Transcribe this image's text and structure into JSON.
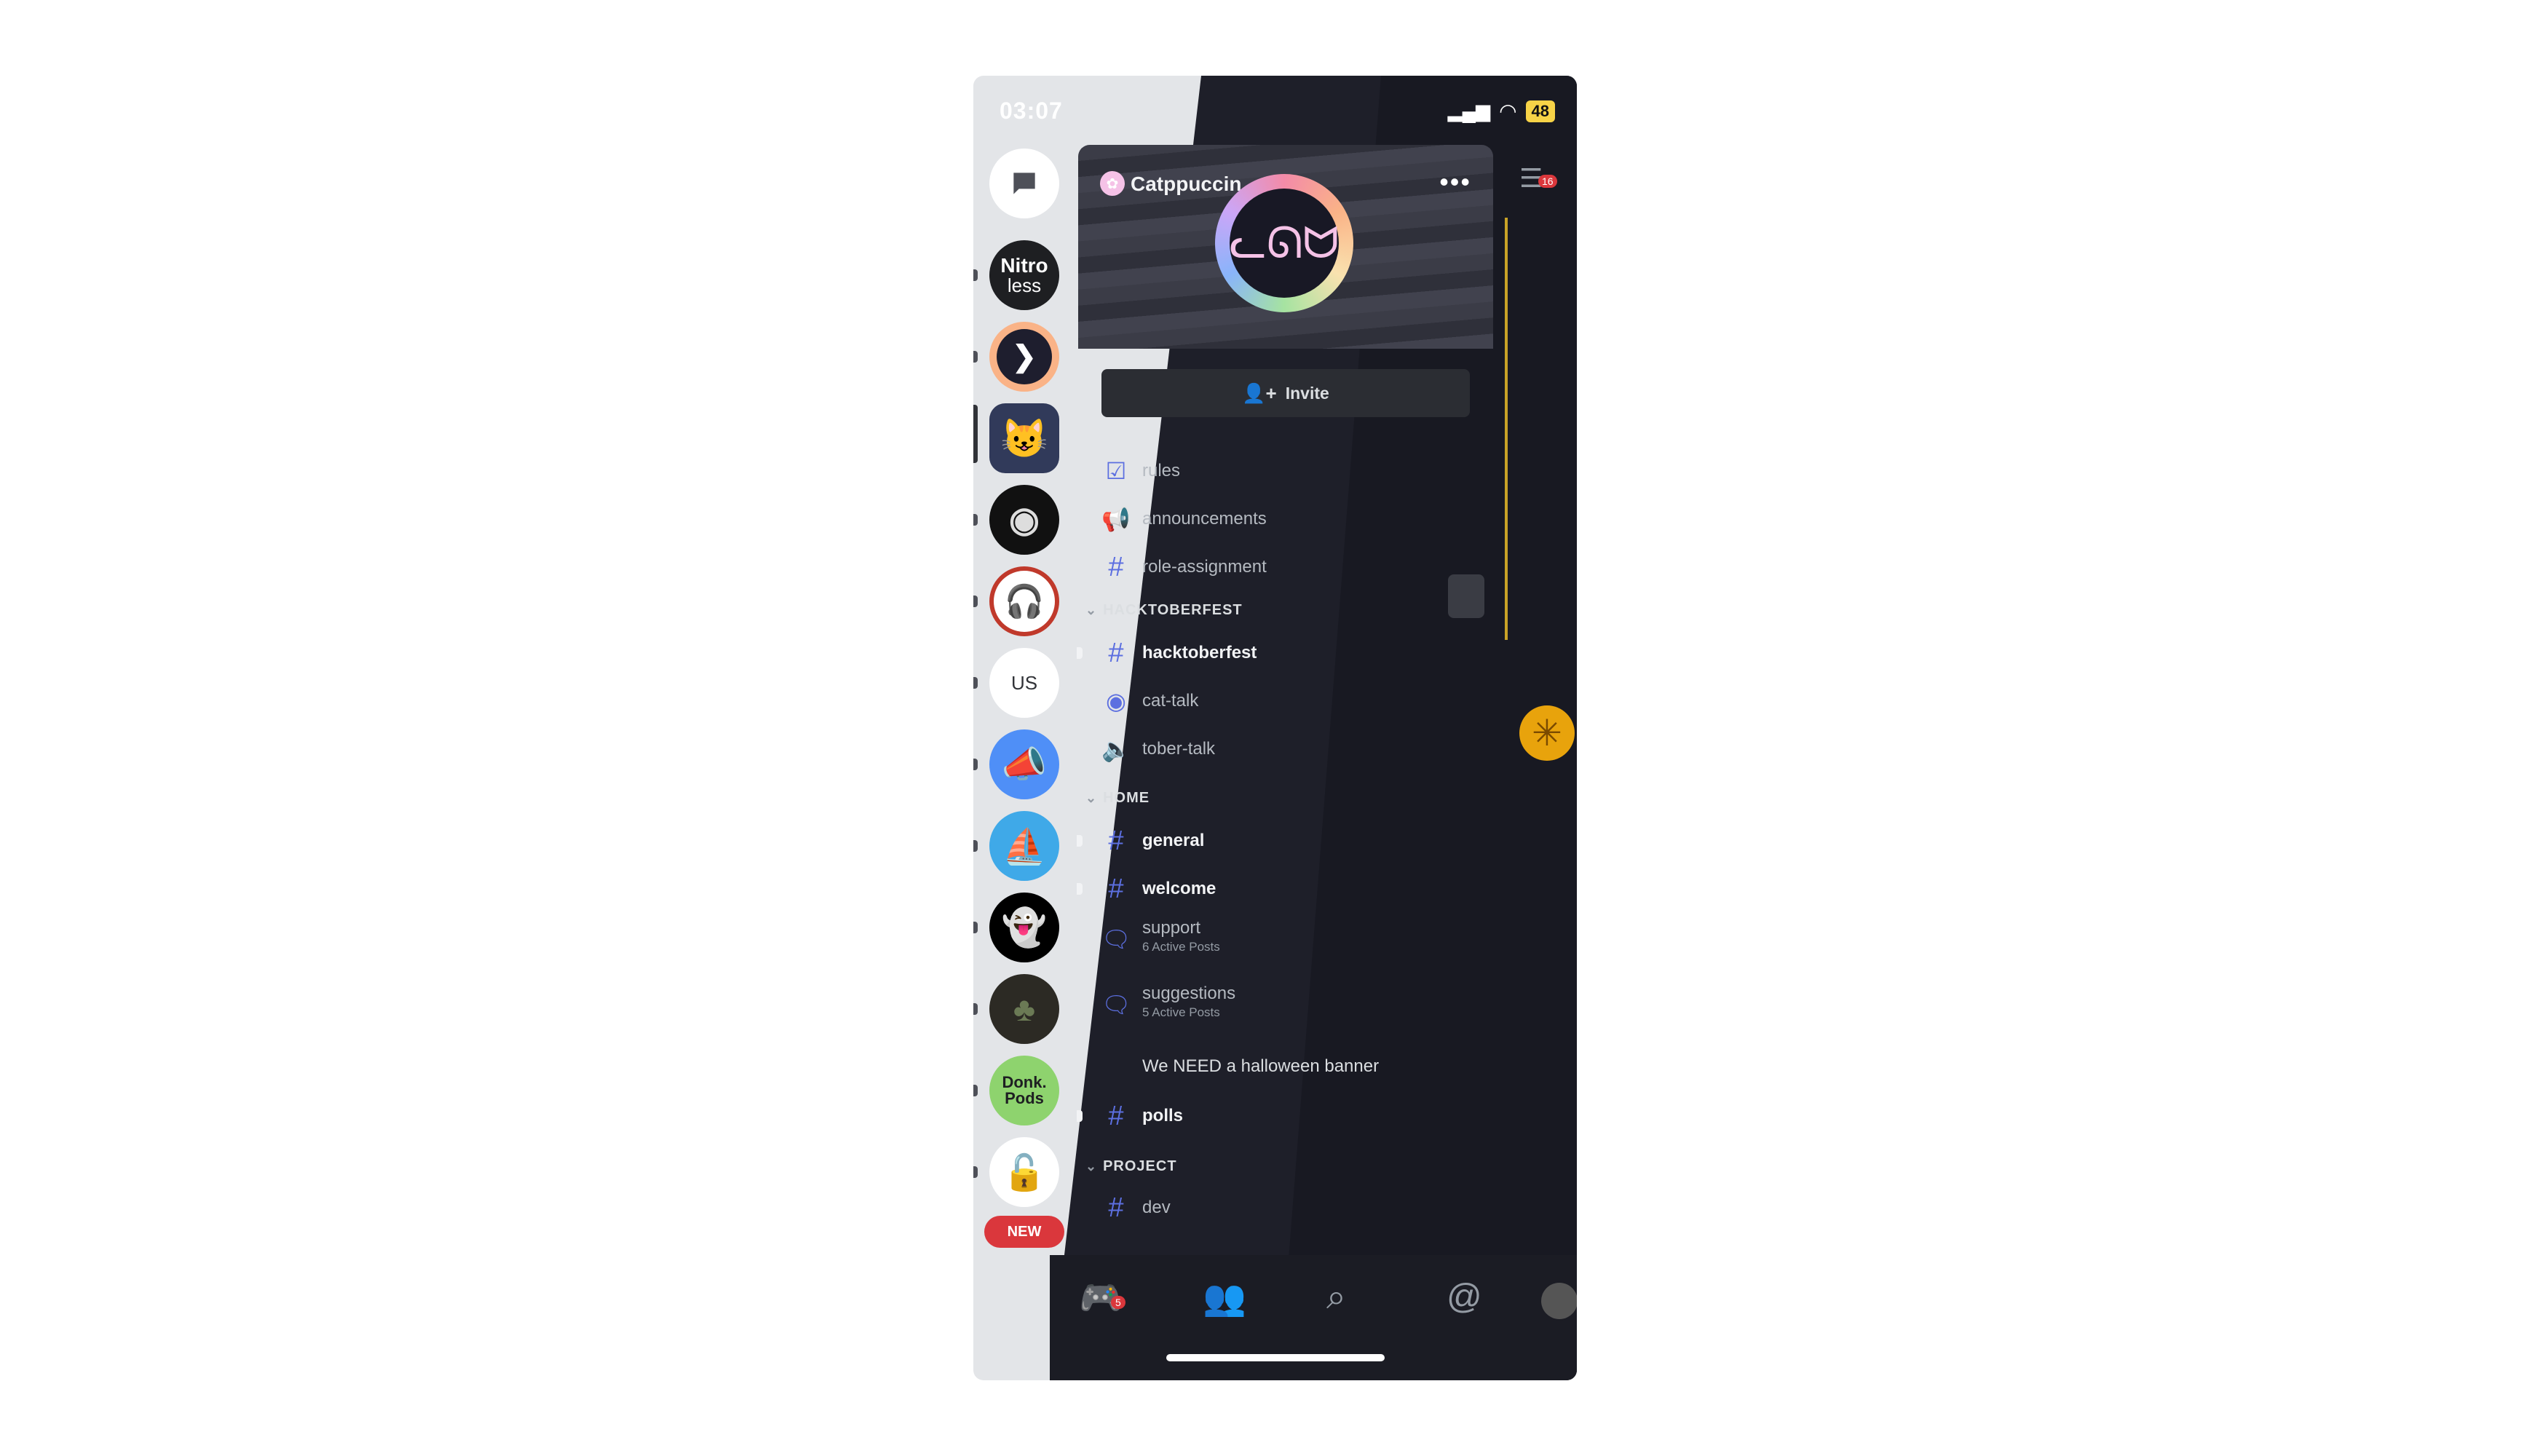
{
  "status_bar": {
    "time": "03:07",
    "battery": "48"
  },
  "servers": [
    {
      "name": "DMs",
      "icon": "chat-bubble-icon",
      "color": "#ffffff"
    },
    {
      "name": "Nitroless",
      "label_top": "Nitro",
      "label_bottom": "less",
      "color": "#1e1f22"
    },
    {
      "name": "Terminal server",
      "icon": "terminal-icon",
      "color": "#fab387"
    },
    {
      "name": "Cat server",
      "icon": "cat-face-icon",
      "color": "#313a5a"
    },
    {
      "name": "Vinyl server",
      "icon": "vinyl-icon",
      "color": "#111111"
    },
    {
      "name": "Headphones server",
      "icon": "headphones-icon",
      "color": "#c0392b"
    },
    {
      "name": "US",
      "label": "US",
      "color": "#ffffff"
    },
    {
      "name": "Megaphone server",
      "icon": "megaphone-icon",
      "color": "#4f8ff7"
    },
    {
      "name": "Ship server",
      "icon": "ship-icon",
      "color": "#3fa9e8"
    },
    {
      "name": "Ghost server",
      "icon": "ghost-icon",
      "color": "#000000"
    },
    {
      "name": "Forest server",
      "icon": "forest-icon",
      "color": "#2c2a24"
    },
    {
      "name": "Donk Pods",
      "label": "Donk. Pods",
      "color": "#8ed36e"
    },
    {
      "name": "Lock server",
      "icon": "lock-icon",
      "color": "#ffffff"
    }
  ],
  "new_badge": "NEW",
  "server_header": {
    "name": "Catppuccin",
    "more_icon": "more-icon"
  },
  "invite_label": "Invite",
  "channels": [
    {
      "icon": "rules-check-icon",
      "label": "rules",
      "bold": false
    },
    {
      "icon": "announcement-icon",
      "label": "announcements",
      "bold": false
    },
    {
      "icon": "hash-icon",
      "label": "role-assignment",
      "bold": false
    },
    {
      "category": "HACKTOBERFEST"
    },
    {
      "icon": "hash-icon",
      "label": "hacktoberfest",
      "bold": true,
      "unread": true
    },
    {
      "icon": "stage-icon",
      "label": "cat-talk",
      "bold": false
    },
    {
      "icon": "voice-icon",
      "label": "tober-talk",
      "bold": false
    },
    {
      "category": "HOME"
    },
    {
      "icon": "hash-icon",
      "label": "general",
      "bold": true,
      "unread": true
    },
    {
      "icon": "hash-thread-icon",
      "label": "welcome",
      "bold": true,
      "unread": true
    },
    {
      "icon": "forum-icon",
      "label": "support",
      "sub": "6 Active Posts",
      "bold": false
    },
    {
      "icon": "forum-icon",
      "label": "suggestions",
      "sub": "5 Active Posts",
      "bold": false
    },
    {
      "thread": "We NEED a halloween banner"
    },
    {
      "icon": "hash-thread-icon",
      "label": "polls",
      "bold": true,
      "unread": true
    },
    {
      "category": "PROJECT"
    },
    {
      "icon": "hash-icon",
      "label": "dev",
      "bold": false
    }
  ],
  "right_strip": {
    "badge": "16"
  },
  "tabbar": {
    "home_badge": "5"
  }
}
